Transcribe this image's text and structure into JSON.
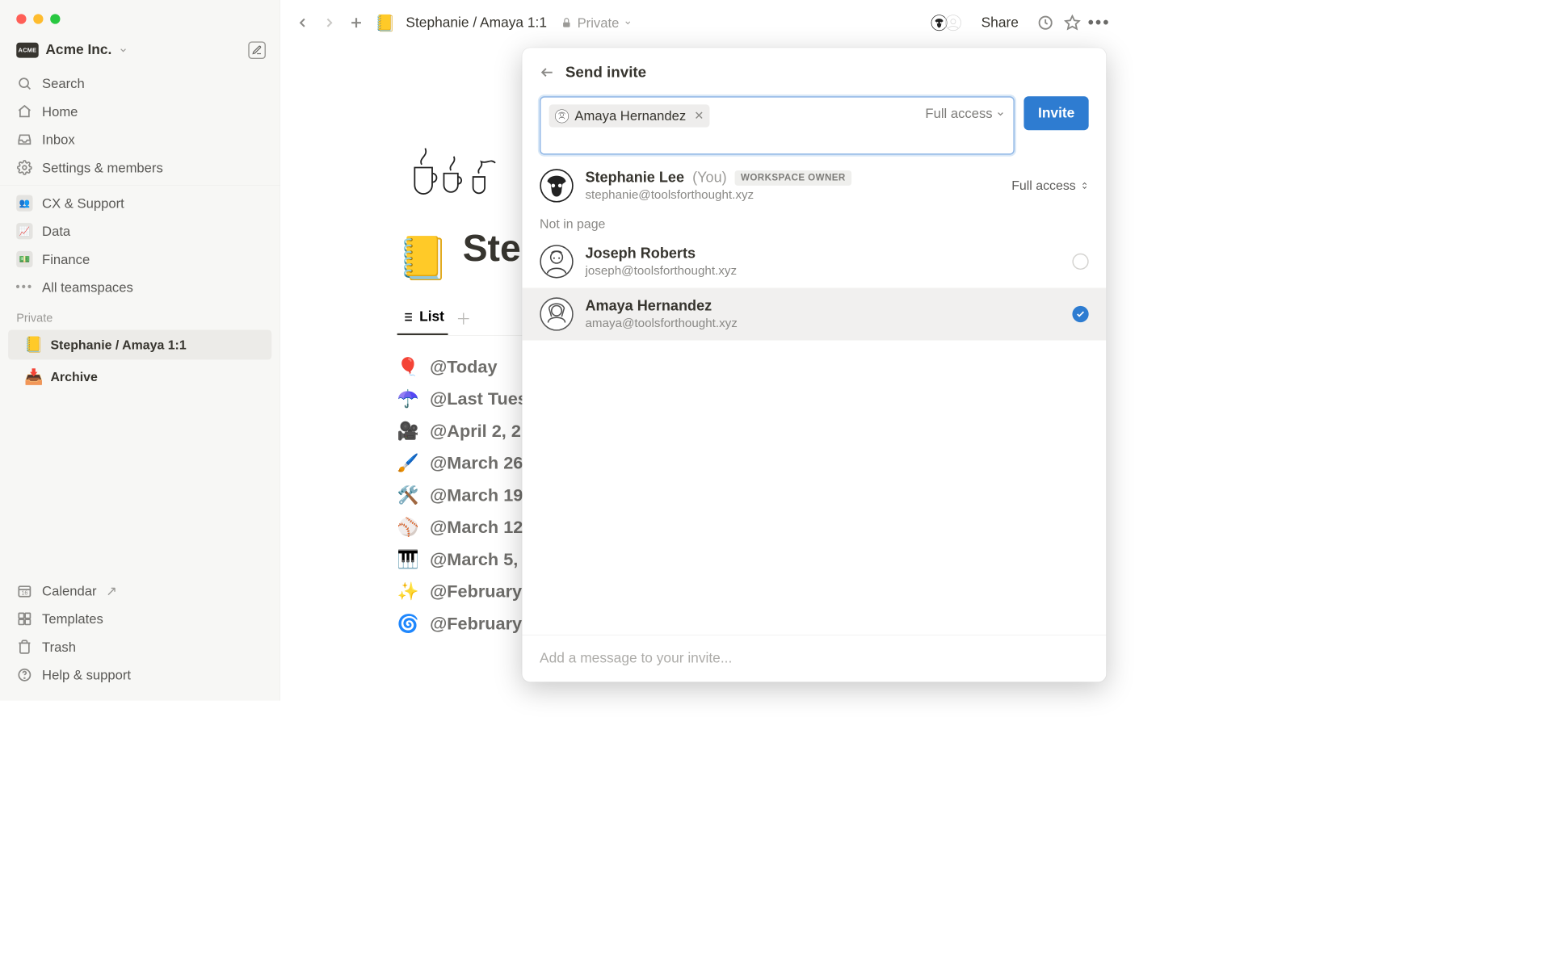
{
  "workspace": {
    "badge": "ACME",
    "name": "Acme Inc."
  },
  "sidebar": {
    "search": "Search",
    "home": "Home",
    "inbox": "Inbox",
    "settings": "Settings & members",
    "teams": [
      "CX & Support",
      "Data",
      "Finance"
    ],
    "all_teamspaces": "All teamspaces",
    "private_label": "Private",
    "pages": [
      {
        "emoji": "📒",
        "name": "Stephanie / Amaya 1:1",
        "active": true
      },
      {
        "emoji": "📥",
        "name": "Archive",
        "active": false
      }
    ],
    "calendar": "Calendar",
    "templates": "Templates",
    "trash": "Trash",
    "help": "Help & support"
  },
  "topbar": {
    "page_emoji": "📒",
    "breadcrumb": "Stephanie / Amaya 1:1",
    "privacy": "Private",
    "share": "Share"
  },
  "page": {
    "emoji": "📒",
    "title": "Step",
    "list_label": "List",
    "entries": [
      {
        "emoji": "🎈",
        "label": "@Today"
      },
      {
        "emoji": "☂️",
        "label": "@Last Tues"
      },
      {
        "emoji": "🎥",
        "label": "@April 2, 2"
      },
      {
        "emoji": "🖌️",
        "label": "@March 26"
      },
      {
        "emoji": "🛠️",
        "label": "@March 19"
      },
      {
        "emoji": "⚾",
        "label": "@March 12"
      },
      {
        "emoji": "🎹",
        "label": "@March 5,"
      },
      {
        "emoji": "✨",
        "label": "@February"
      },
      {
        "emoji": "🌀",
        "label": "@February"
      }
    ]
  },
  "invite": {
    "title": "Send invite",
    "chip_name": "Amaya Hernandez",
    "access": "Full access",
    "button": "Invite",
    "owner": {
      "name": "Stephanie Lee",
      "you": "(You)",
      "pill": "WORKSPACE OWNER",
      "email": "stephanie@toolsforthought.xyz",
      "access": "Full access"
    },
    "not_in_page": "Not in page",
    "people": [
      {
        "name": "Joseph Roberts",
        "email": "joseph@toolsforthought.xyz",
        "selected": false
      },
      {
        "name": "Amaya Hernandez",
        "email": "amaya@toolsforthought.xyz",
        "selected": true
      }
    ],
    "message_placeholder": "Add a message to your invite..."
  }
}
